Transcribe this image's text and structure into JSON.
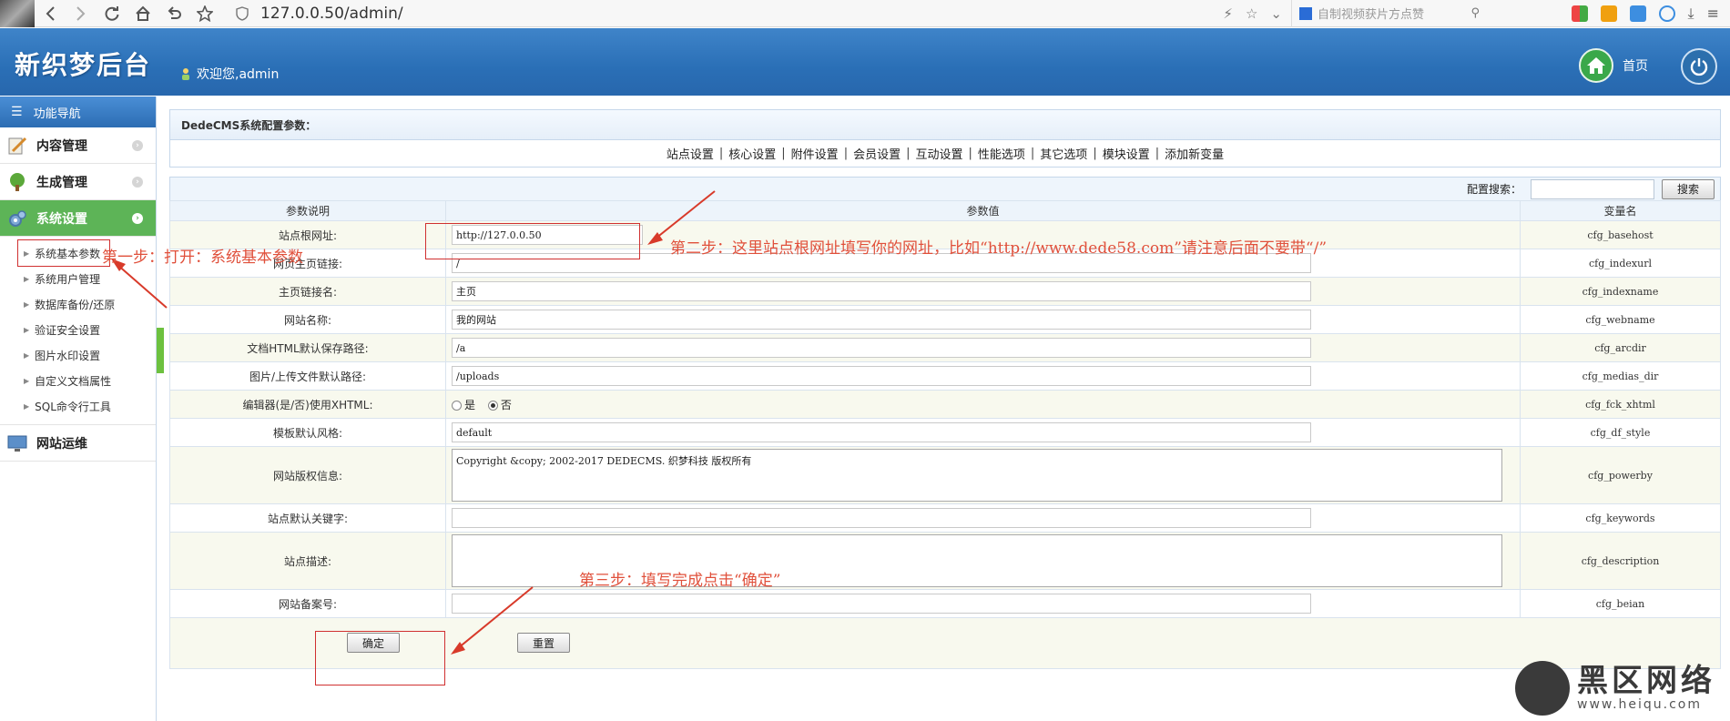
{
  "browser": {
    "url": "127.0.0.50/admin/",
    "search_placeholder": "自制视频获片方点赞"
  },
  "header": {
    "logo": "新织梦后台",
    "welcome": "欢迎您,admin",
    "home_label": "首页"
  },
  "sidebar": {
    "title": "功能导航",
    "groups": [
      {
        "label": "内容管理"
      },
      {
        "label": "生成管理"
      },
      {
        "label": "系统设置"
      },
      {
        "label": "网站运维"
      }
    ],
    "sub_items": [
      {
        "label": "系统基本参数"
      },
      {
        "label": "系统用户管理"
      },
      {
        "label": "数据库备份/还原"
      },
      {
        "label": "验证安全设置"
      },
      {
        "label": "图片水印设置"
      },
      {
        "label": "自定义文档属性"
      },
      {
        "label": "SQL命令行工具"
      }
    ]
  },
  "config": {
    "heading": "DedeCMS系统配置参数：",
    "tabs": [
      "站点设置",
      "核心设置",
      "附件设置",
      "会员设置",
      "互动设置",
      "性能选项",
      "其它选项",
      "模块设置",
      "添加新变量"
    ],
    "search_label": "配置搜索：",
    "search_button": "搜索",
    "columns": {
      "desc": "参数说明",
      "value": "参数值",
      "var": "变量名"
    },
    "rows": [
      {
        "label": "站点根网址:",
        "value": "http://127.0.0.50",
        "var": "cfg_basehost"
      },
      {
        "label": "网页主页链接:",
        "value": "/",
        "var": "cfg_indexurl"
      },
      {
        "label": "主页链接名:",
        "value": "主页",
        "var": "cfg_indexname"
      },
      {
        "label": "网站名称:",
        "value": "我的网站",
        "var": "cfg_webname"
      },
      {
        "label": "文档HTML默认保存路径:",
        "value": "/a",
        "var": "cfg_arcdir"
      },
      {
        "label": "图片/上传文件默认路径:",
        "value": "/uploads",
        "var": "cfg_medias_dir"
      },
      {
        "label": "编辑器(是/否)使用XHTML:",
        "radio_yes": "是",
        "radio_no": "否",
        "var": "cfg_fck_xhtml"
      },
      {
        "label": "模板默认风格:",
        "value": "default",
        "var": "cfg_df_style"
      },
      {
        "label": "网站版权信息:",
        "value": "Copyright &copy; 2002-2017 DEDECMS. 织梦科技 版权所有",
        "var": "cfg_powerby"
      },
      {
        "label": "站点默认关键字:",
        "value": "",
        "var": "cfg_keywords"
      },
      {
        "label": "站点描述:",
        "value": "",
        "var": "cfg_description"
      },
      {
        "label": "网站备案号:",
        "value": "",
        "var": "cfg_beian"
      }
    ],
    "ok_button": "确定",
    "reset_button": "重置"
  },
  "annotations": {
    "step1": "第一步：打开：系统基本参数",
    "step2": "第二步：这里站点根网址填写你的网址，比如“http://www.dede58.com”请注意后面不要带“/”",
    "step3": "第三步：填写完成点击“确定”"
  },
  "watermark": {
    "title": "黑区网络",
    "url": "www.heiqu.com"
  }
}
